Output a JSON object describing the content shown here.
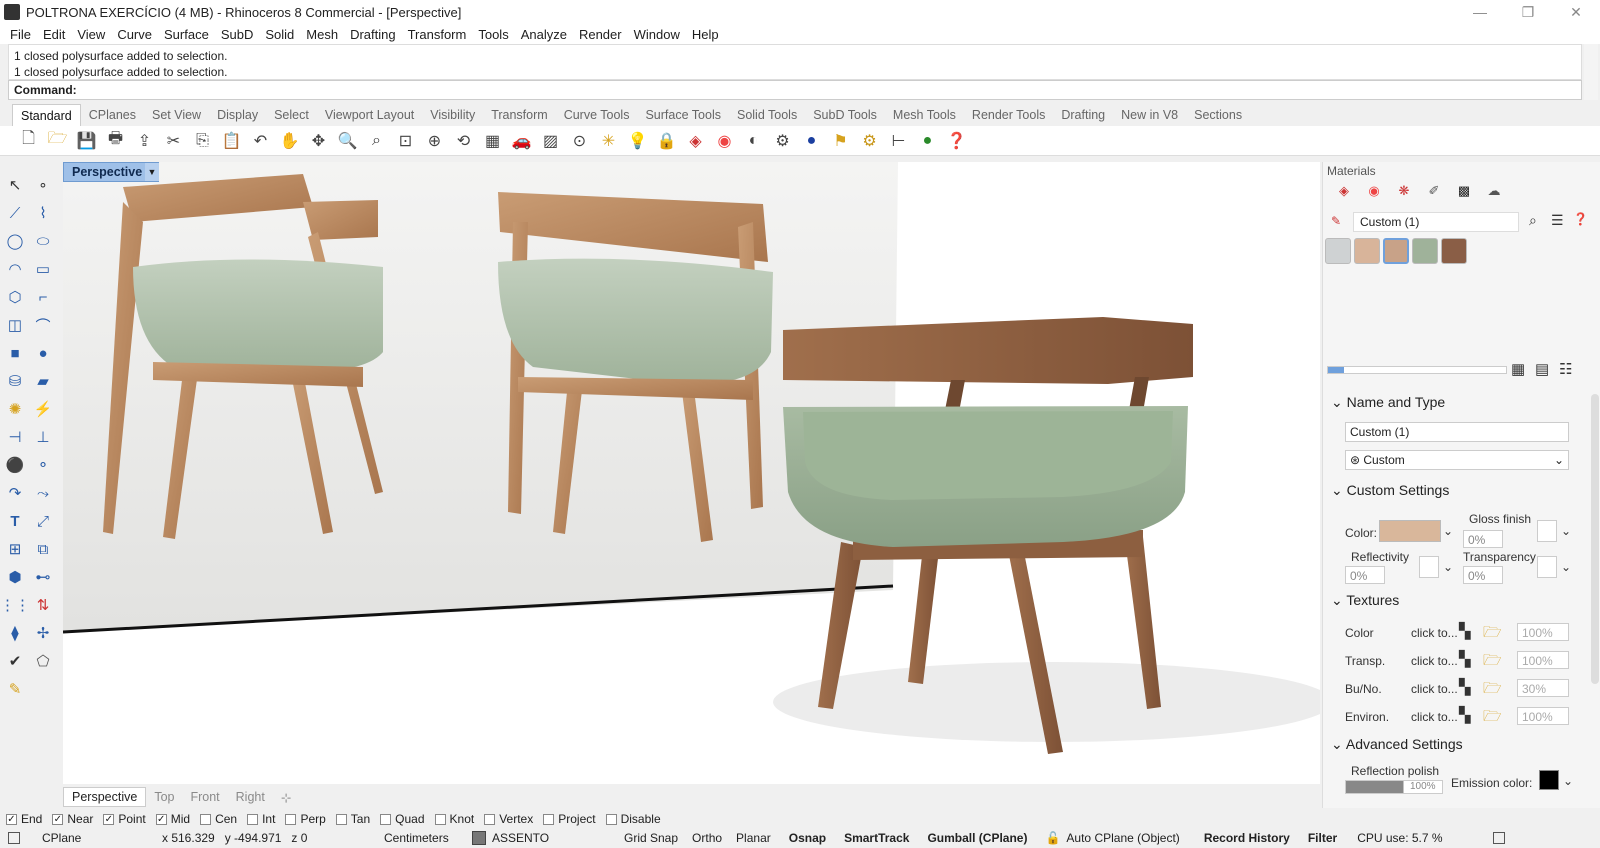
{
  "window": {
    "title": "POLTRONA EXERCÍCIO (4 MB) - Rhinoceros 8 Commercial - [Perspective]"
  },
  "menu": [
    "File",
    "Edit",
    "View",
    "Curve",
    "Surface",
    "SubD",
    "Solid",
    "Mesh",
    "Drafting",
    "Transform",
    "Tools",
    "Analyze",
    "Render",
    "Window",
    "Help"
  ],
  "command": {
    "history": [
      "1 closed polysurface added to selection.",
      "1 closed polysurface added to selection."
    ],
    "prompt": "Command:"
  },
  "toolbar_tabs": [
    "Standard",
    "CPlanes",
    "Set View",
    "Display",
    "Select",
    "Viewport Layout",
    "Visibility",
    "Transform",
    "Curve Tools",
    "Surface Tools",
    "Solid Tools",
    "SubD Tools",
    "Mesh Tools",
    "Render Tools",
    "Drafting",
    "New in V8",
    "Sections"
  ],
  "viewport": {
    "label": "Perspective"
  },
  "view_tabs": [
    "Perspective",
    "Top",
    "Front",
    "Right"
  ],
  "materials": {
    "header": "Materials",
    "current": "Custom (1)",
    "name_type_section": "Name and Type",
    "name_value": "Custom (1)",
    "type_value": "Custom",
    "custom_section": "Custom Settings",
    "color_label": "Color:",
    "gloss_label": "Gloss finish",
    "gloss_value": "0%",
    "reflectivity_label": "Reflectivity",
    "reflectivity_value": "0%",
    "transparency_label": "Transparency",
    "transparency_value": "0%",
    "textures_section": "Textures",
    "textures": [
      {
        "name": "Color",
        "hint": "click to...",
        "amount": "100%"
      },
      {
        "name": "Transp.",
        "hint": "click to...",
        "amount": "100%"
      },
      {
        "name": "Bu/No.",
        "hint": "click to...",
        "amount": "30%"
      },
      {
        "name": "Environ.",
        "hint": "click to...",
        "amount": "100%"
      }
    ],
    "advanced_section": "Advanced Settings",
    "reflection_polish": "Reflection polish",
    "reflection_value": "100%",
    "emission_label": "Emission color:",
    "color_swatch": "#d9b79b"
  },
  "osnaps": [
    {
      "label": "End",
      "on": true
    },
    {
      "label": "Near",
      "on": true
    },
    {
      "label": "Point",
      "on": true
    },
    {
      "label": "Mid",
      "on": true
    },
    {
      "label": "Cen",
      "on": false
    },
    {
      "label": "Int",
      "on": false
    },
    {
      "label": "Perp",
      "on": false
    },
    {
      "label": "Tan",
      "on": false
    },
    {
      "label": "Quad",
      "on": false
    },
    {
      "label": "Knot",
      "on": false
    },
    {
      "label": "Vertex",
      "on": false
    },
    {
      "label": "Project",
      "on": false
    },
    {
      "label": "Disable",
      "on": false
    }
  ],
  "status": {
    "cplane": "CPlane",
    "coords": "x 516.329   y -494.971   z 0",
    "units": "Centimeters",
    "layer": "ASSENTO",
    "grid_snap": "Grid Snap",
    "ortho": "Ortho",
    "planar": "Planar",
    "osnap": "Osnap",
    "smarttrack": "SmartTrack",
    "gumball": "Gumball (CPlane)",
    "autocplane": "Auto CPlane (Object)",
    "record_history": "Record History",
    "filter": "Filter",
    "cpu": "CPU use: 5.7 %"
  }
}
